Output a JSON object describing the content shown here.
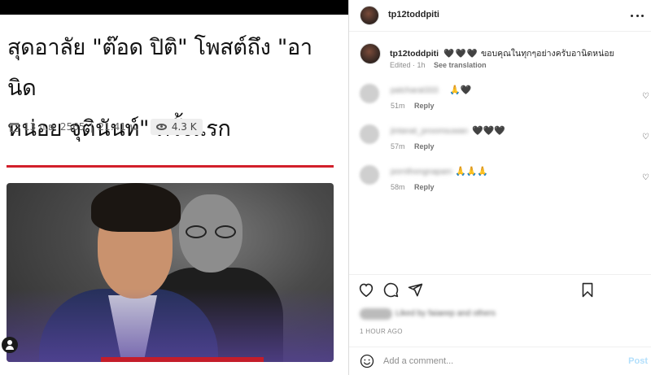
{
  "article": {
    "headline_line1": "สุดอาลัย \"ต๊อด ปิติ\" โพสต์ถึง \"อานิด",
    "headline_line2": "หน่อย จุตินันท์\" ครั้งแรก",
    "date": "13 ก.ย. 2565",
    "time": "21:41 น.",
    "views": "4.3 K",
    "accent_color": "#d21f2b"
  },
  "post": {
    "username": "tp12toddpiti",
    "caption_username": "tp12toddpiti",
    "caption_hearts": "🖤🖤🖤",
    "caption_text": "ขอบคุณในทุกๆอย่างครับอานิดหน่อย",
    "edited": "Edited · 1h",
    "see_translation": "See translation",
    "comments": [
      {
        "name": "patcharat333",
        "text": "🙏🖤",
        "age": "51m",
        "reply": "Reply"
      },
      {
        "name": "jintanat_proomsuwan",
        "text": "🖤🖤🖤",
        "age": "57m",
        "reply": "Reply"
      },
      {
        "name": "pornthongnapam",
        "text": "🙏🙏🙏",
        "age": "58m",
        "reply": "Reply"
      }
    ],
    "liked_by": "Liked by faiaeep and others",
    "timestamp": "1 HOUR AGO",
    "add_comment_placeholder": "Add a comment...",
    "post_label": "Post"
  }
}
